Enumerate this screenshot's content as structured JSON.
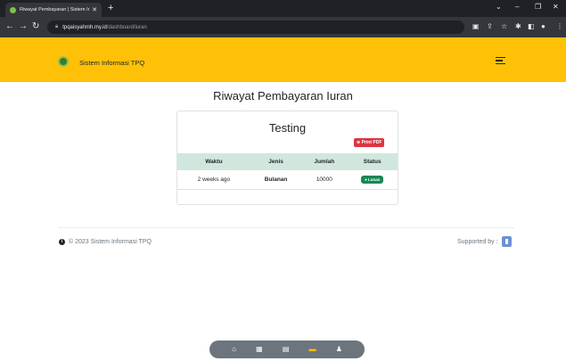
{
  "browser": {
    "tab_title": "Riwayat Pembayaran | Sistem Inf…",
    "url_host": "tpqaisyahmh.my.id",
    "url_path": "/dashboard/iuran"
  },
  "navbar": {
    "brand": "Sistem Informasi TPQ"
  },
  "page": {
    "title": "Riwayat Pembayaran Iuran"
  },
  "card": {
    "title": "Testing",
    "print_button": "Print PDF",
    "columns": [
      "Waktu",
      "Jenis",
      "Jumlah",
      "Status"
    ],
    "rows": [
      {
        "waktu": "2 weeks ago",
        "jenis": "Bulanan",
        "jumlah": "10000",
        "status": "Lunas"
      }
    ]
  },
  "footer": {
    "copyright": "© 2023 Sistem Informasi TPQ",
    "supported_by": "Supported by :"
  },
  "colors": {
    "navbar": "#ffc107",
    "table_header": "#d1e7dd",
    "badge": "#198754",
    "print_button": "#dc3545"
  },
  "bottom_nav": {
    "icons": [
      "home-icon",
      "calculator-icon",
      "clipboard-icon",
      "wallet-icon",
      "users-icon"
    ],
    "active_index": 3
  }
}
